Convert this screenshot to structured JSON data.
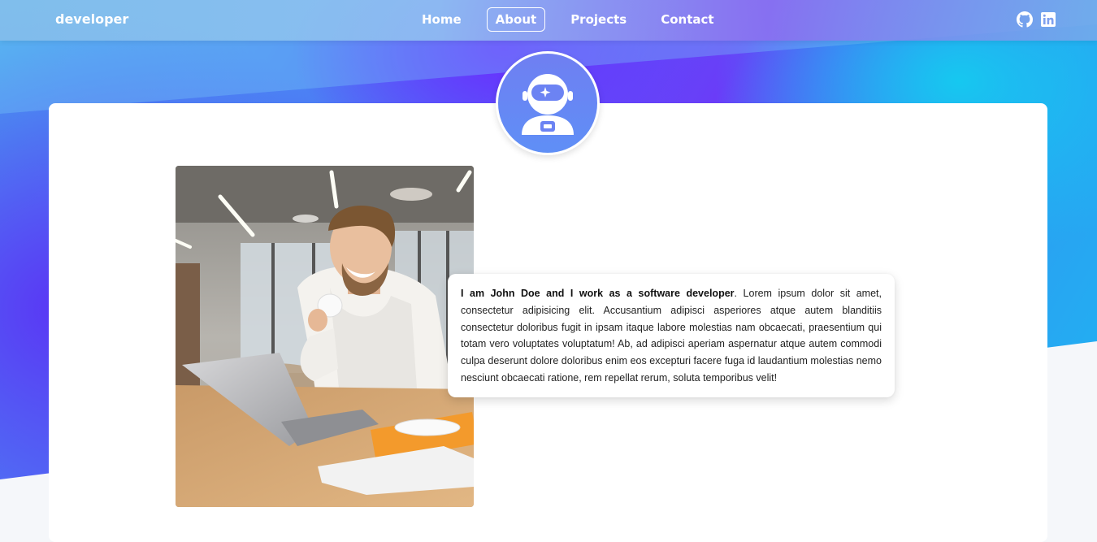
{
  "brand": "developer",
  "nav": {
    "items": [
      {
        "label": "Home",
        "active": false
      },
      {
        "label": "About",
        "active": true
      },
      {
        "label": "Projects",
        "active": false
      },
      {
        "label": "Contact",
        "active": false
      }
    ]
  },
  "social": {
    "icons": [
      "github-icon",
      "linkedin-icon"
    ]
  },
  "profile": {
    "avatar_icon": "astronaut-icon",
    "photo_alt": "man-with-coffee-and-laptop"
  },
  "bio": {
    "lead": "I am John Doe and I work as a software developer",
    "text": ". Lorem ipsum dolor sit amet, consectetur adipisicing elit. Accusantium adipisci asperiores atque autem blanditiis consectetur doloribus fugit in ipsam itaque labore molestias nam obcaecati, praesentium qui totam vero voluptates voluptatum! Ab, ad adipisci aperiam aspernatur atque autem commodi culpa deserunt dolore doloribus enim eos excepturi facere fuga id laudantium molestias nemo nesciunt obcaecati ratione, rem repellat rerum, soluta temporibus velit!"
  },
  "colors": {
    "accent_purple": "#6a2cff",
    "accent_cyan": "#16c8f0",
    "avatar_bg": "#6f7ff2"
  }
}
